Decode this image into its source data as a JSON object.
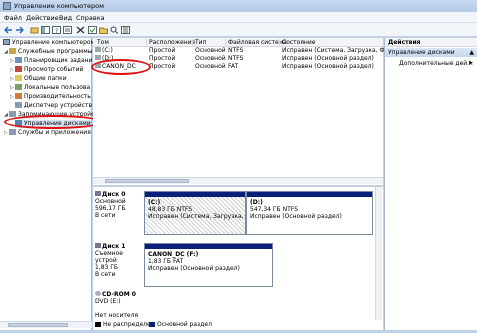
{
  "window": {
    "title": "Управление компьютером"
  },
  "menu": [
    "Файл",
    "Действие",
    "Вид",
    "Справка"
  ],
  "tree": {
    "root": "Управление компьютером (л",
    "items": [
      {
        "label": "Служебные программы",
        "level": 1,
        "arrow": "◢"
      },
      {
        "label": "Планировщик задани",
        "level": 2,
        "arrow": "▷"
      },
      {
        "label": "Просмотр событий",
        "level": 2,
        "arrow": "▷"
      },
      {
        "label": "Общие папки",
        "level": 2,
        "arrow": "▷"
      },
      {
        "label": "Локальные пользова",
        "level": 2,
        "arrow": "▷"
      },
      {
        "label": "Производительность",
        "level": 2,
        "arrow": "▷"
      },
      {
        "label": "Диспетчер устройств",
        "level": 2,
        "arrow": ""
      },
      {
        "label": "Запоминающие устройст",
        "level": 1,
        "arrow": "◢"
      },
      {
        "label": "Управление дисками",
        "level": 2,
        "arrow": ""
      },
      {
        "label": "Службы и приложения",
        "level": 1,
        "arrow": "▷"
      }
    ]
  },
  "volumes": {
    "headers": [
      "Том",
      "Расположение",
      "Тип",
      "Файловая система",
      "Состояние"
    ],
    "rows": [
      [
        "(C:)",
        "Простой",
        "Основной",
        "NTFS",
        "Исправен (Система, Загрузка, Файл ..."
      ],
      [
        "(D:)",
        "Простой",
        "Основной",
        "NTFS",
        "Исправен (Основной раздел)"
      ],
      [
        "CANON_DC",
        "Простой",
        "Основной",
        "FAT",
        "Исправен (Основной раздел)"
      ]
    ]
  },
  "disks": [
    {
      "name": "Диск 0",
      "lines": [
        "Основной",
        "596,17 ГБ",
        "В сети"
      ],
      "partitions": [
        {
          "name": "(C:)",
          "size": "48,83 ГБ NTFS",
          "status": "Исправен (Система, Загрузка, Фай"
        },
        {
          "name": "(D:)",
          "size": "547,34 ГБ NTFS",
          "status": "Исправен (Основной раздел)"
        }
      ]
    },
    {
      "name": "Диск 1",
      "lines": [
        "Съемное устрой",
        "1,83 ГБ",
        "В сети"
      ],
      "partitions": [
        {
          "name": "CANON_DC  (F:)",
          "size": "1,83 ГБ FAT",
          "status": "Исправен (Основной раздел)"
        }
      ]
    },
    {
      "name": "CD-ROM 0",
      "lines": [
        "DVD (E:)",
        "",
        "Нет носителя"
      ],
      "partitions": []
    }
  ],
  "legend": {
    "unallocated": "Не распределен",
    "primary": "Основной раздел",
    "unallocated_color": "#000000",
    "primary_color": "#0a1f7a"
  },
  "actions": {
    "header": "Действия",
    "subheader": "Управление дисками",
    "item": "Дополнительные дей..."
  },
  "colors": {
    "annotation": "#dd1111",
    "partition_bar": "#0a1f7a",
    "selected": "#c6d7ec"
  }
}
